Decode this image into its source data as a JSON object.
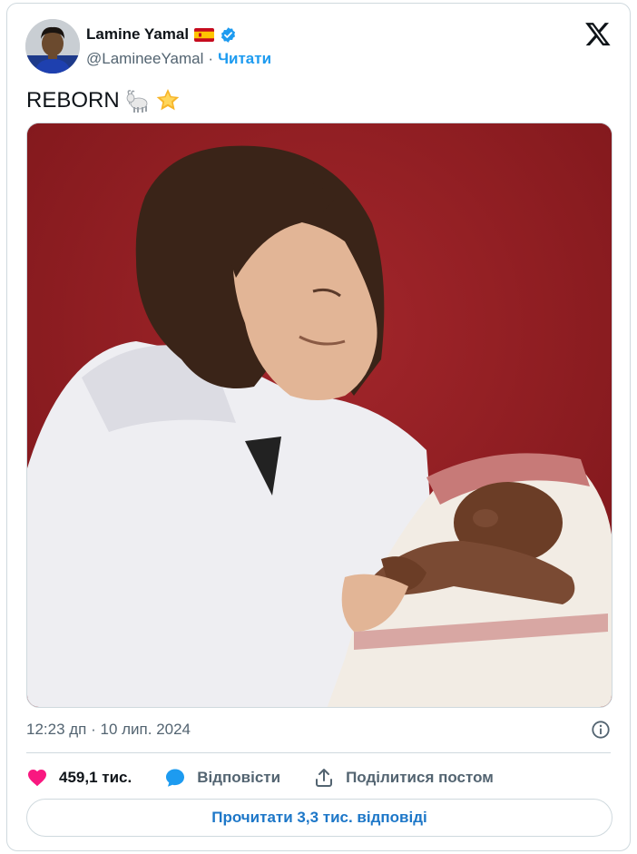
{
  "user": {
    "display_name": "Lamine Yamal",
    "handle": "@LamineeYamal",
    "separator": "·",
    "follow_label": "Читати",
    "flag_icon": "spain-flag-icon",
    "verified_icon": "verified-badge-icon"
  },
  "tweet": {
    "text": "REBORN",
    "emojis": [
      "goat-emoji",
      "glowing-star-emoji"
    ],
    "timestamp": "12:23 дп · 10 лип. 2024"
  },
  "actions": {
    "like_count": "459,1 тис.",
    "reply_label": "Відповісти",
    "share_label": "Поділитися постом"
  },
  "read_replies_label": "Прочитати 3,3 тис. відповіді",
  "colors": {
    "accent": "#1d9bf0",
    "like": "#f91880",
    "reply": "#1d9bf0",
    "muted": "#536471",
    "photo_background": "#8b1a1f"
  }
}
